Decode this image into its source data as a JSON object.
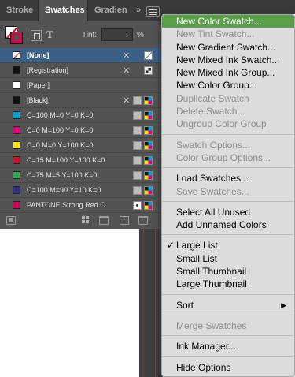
{
  "panel": {
    "tabs": [
      {
        "label": "Stroke"
      },
      {
        "label": "Swatches"
      },
      {
        "label": "Gradient"
      }
    ],
    "tab_overflow": "»",
    "controls": {
      "tint_label": "Tint:",
      "tint_value": "",
      "tint_unit": "%"
    },
    "swatches": [
      {
        "name": "[None]",
        "color": "#ffffff",
        "selected": true
      },
      {
        "name": "[Registration]",
        "color": "#111111",
        "selected": false
      },
      {
        "name": "[Paper]",
        "color": "#ffffff",
        "selected": false
      },
      {
        "name": "[Black]",
        "color": "#111111",
        "selected": false
      },
      {
        "name": "C=100 M=0 Y=0 K=0",
        "color": "#00a0e0",
        "selected": false
      },
      {
        "name": "C=0 M=100 Y=0 K=0",
        "color": "#e4007c",
        "selected": false
      },
      {
        "name": "C=0 M=0 Y=100 K=0",
        "color": "#ffe800",
        "selected": false
      },
      {
        "name": "C=15 M=100 Y=100 K=0",
        "color": "#c8102e",
        "selected": false
      },
      {
        "name": "C=75 M=5 Y=100 K=0",
        "color": "#34a853",
        "selected": false
      },
      {
        "name": "C=100 M=90 Y=10 K=0",
        "color": "#2e2f86",
        "selected": false
      },
      {
        "name": "PANTONE Strong Red C",
        "color": "#ce0058",
        "selected": false
      }
    ]
  },
  "menu": {
    "items": [
      {
        "label": "New Color Swatch...",
        "disabled": false,
        "highlight": true
      },
      {
        "label": "New Tint Swatch...",
        "disabled": true
      },
      {
        "label": "New Gradient Swatch...",
        "disabled": false
      },
      {
        "label": "New Mixed Ink Swatch...",
        "disabled": false
      },
      {
        "label": "New Mixed Ink Group...",
        "disabled": false
      },
      {
        "label": "New Color Group...",
        "disabled": false
      },
      {
        "label": "Duplicate Swatch",
        "disabled": true
      },
      {
        "label": "Delete Swatch...",
        "disabled": true
      },
      {
        "label": "Ungroup Color Group",
        "disabled": true
      },
      {
        "label": "Swatch Options...",
        "disabled": true
      },
      {
        "label": "Color Group Options...",
        "disabled": true
      },
      {
        "label": "Load Swatches...",
        "disabled": false
      },
      {
        "label": "Save Swatches...",
        "disabled": true
      },
      {
        "label": "Select All Unused",
        "disabled": false
      },
      {
        "label": "Add Unnamed Colors",
        "disabled": false
      },
      {
        "label": "Large List",
        "disabled": false,
        "checked": true
      },
      {
        "label": "Small List",
        "disabled": false
      },
      {
        "label": "Small Thumbnail",
        "disabled": false
      },
      {
        "label": "Large Thumbnail",
        "disabled": false
      },
      {
        "label": "Sort",
        "disabled": false,
        "submenu": true
      },
      {
        "label": "Merge Swatches",
        "disabled": true
      },
      {
        "label": "Ink Manager...",
        "disabled": false
      },
      {
        "label": "Hide Options",
        "disabled": false
      }
    ],
    "checkmark": "✓",
    "submenu_arrow": "▶",
    "highlight_color": "#5b9f4a"
  }
}
